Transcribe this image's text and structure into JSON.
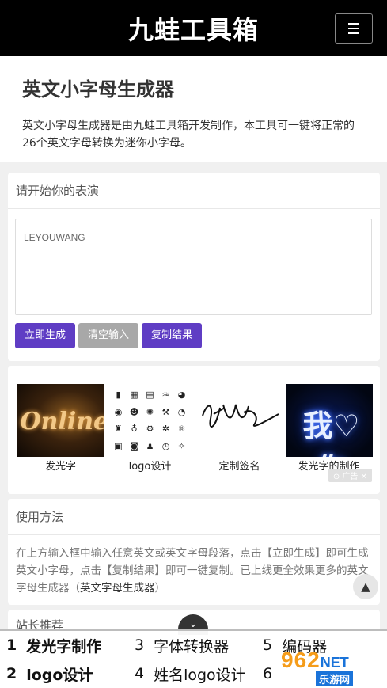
{
  "header": {
    "brand": "九蛙工具箱",
    "menu_icon": "hamburger-icon"
  },
  "intro": {
    "title": "英文小字母生成器",
    "description": "英文小字母生成器是由九蛙工具箱开发制作，本工具可一键将正常的26个英文字母转换为迷你小字母。"
  },
  "input_card": {
    "title": "请开始你的表演",
    "input_value": "LEYOUWANG",
    "buttons": {
      "generate": "立即生成",
      "clear": "清空输入",
      "copy": "复制结果"
    }
  },
  "ads": {
    "items": [
      {
        "caption": "发光字",
        "thumb_text": "Online"
      },
      {
        "caption": "logo设计"
      },
      {
        "caption": "定制签名"
      },
      {
        "caption": "发光字的制作",
        "thumb_text": "我♡你"
      }
    ],
    "tag": "广告"
  },
  "usage_card": {
    "title": "使用方法",
    "text": "在上方输入框中输入任意英文或英文字母段落，点击【立即生成】即可生成英文小字母，点击【复制结果】即可一键复制。已上线更全效果更多的英文字母生成器（",
    "link": "英文字母生成器",
    "text_end": "）"
  },
  "recommend_card": {
    "title": "站长推荐"
  },
  "bottom_nav": {
    "items": [
      {
        "num": "1",
        "label": "发光字制作"
      },
      {
        "num": "3",
        "label": "字体转换器"
      },
      {
        "num": "5",
        "label": "编码器"
      },
      {
        "num": "2",
        "label": "logo设计"
      },
      {
        "num": "4",
        "label": "姓名logo设计"
      },
      {
        "num": "6",
        "label": ""
      }
    ]
  },
  "watermark": {
    "brand": "962",
    "net": "NET",
    "sub": "乐游网"
  },
  "colors": {
    "accent": "#5f3dc4",
    "header_bg": "#000000",
    "gray_button": "#a8a8a8"
  }
}
